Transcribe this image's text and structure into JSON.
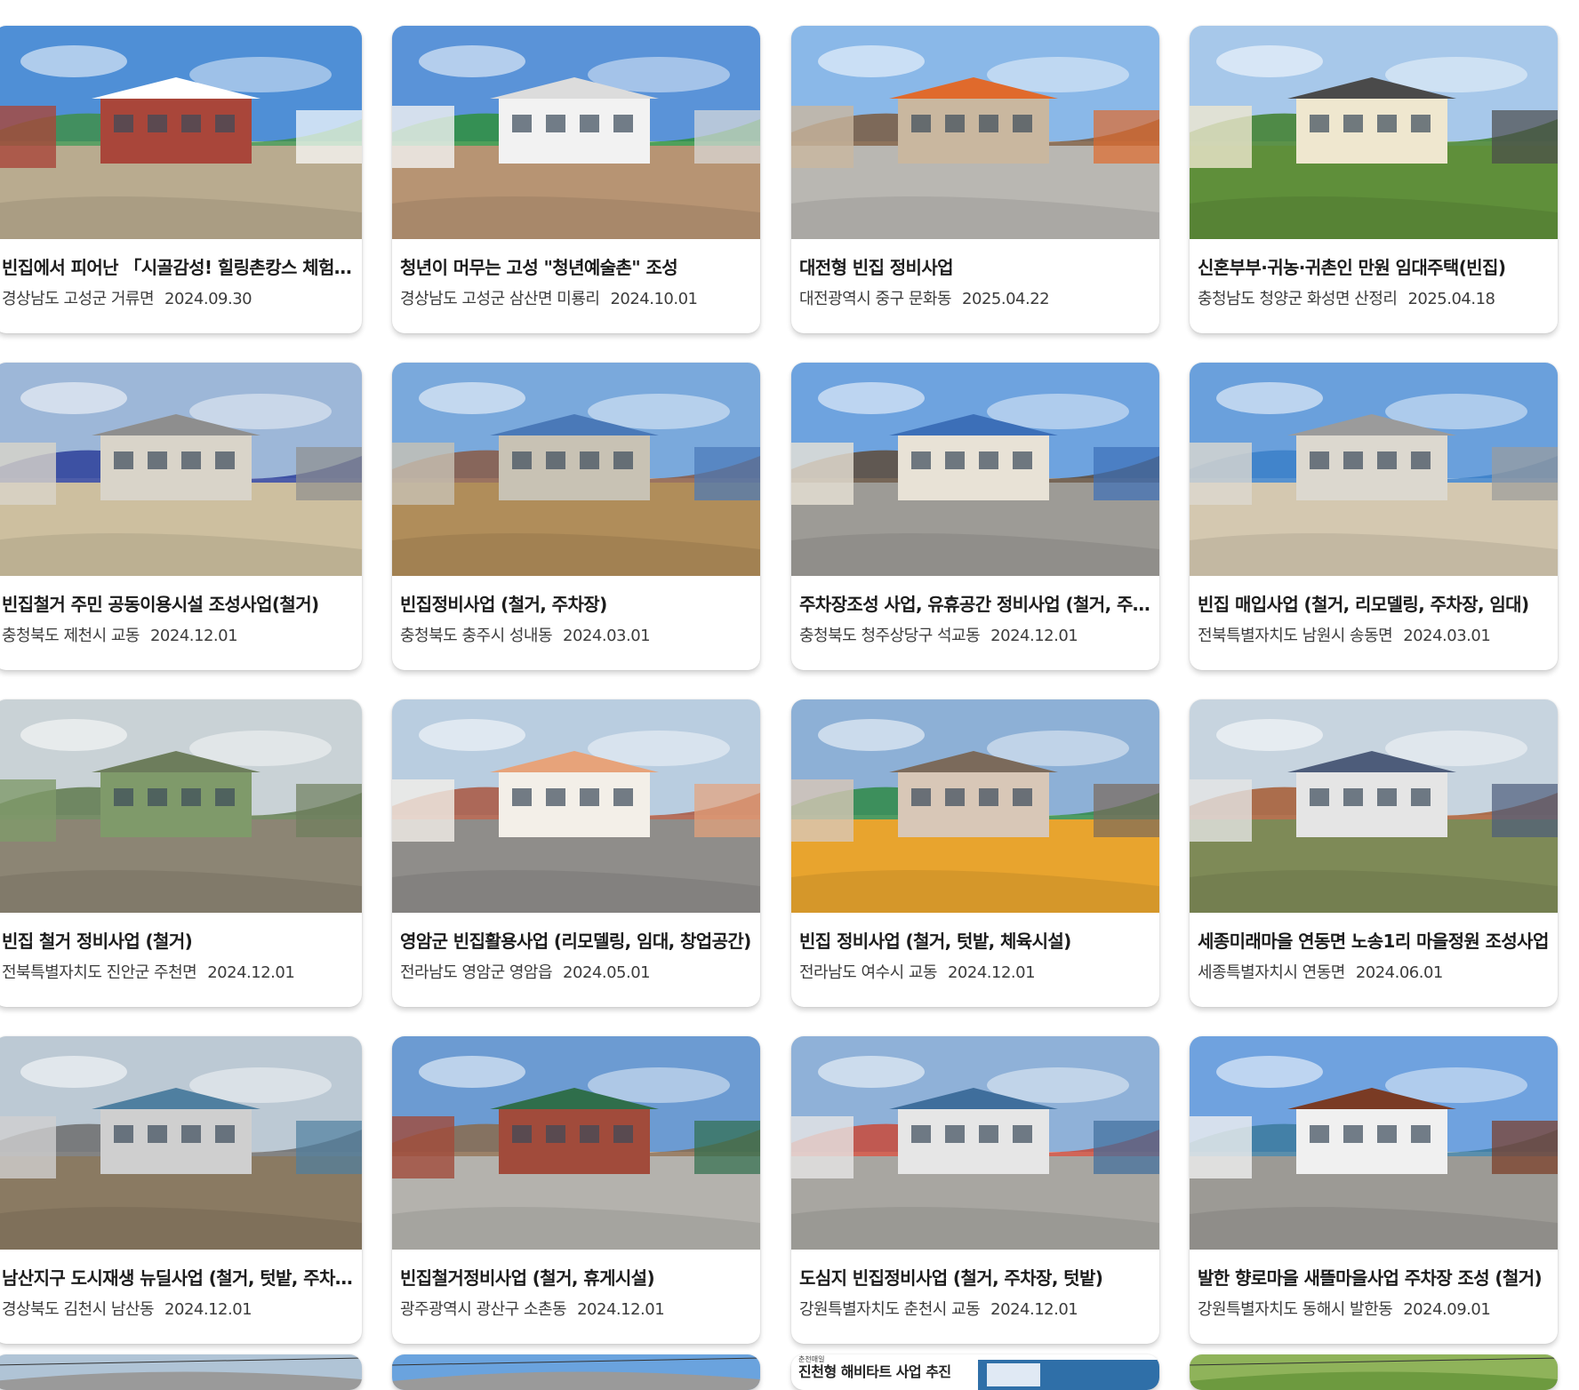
{
  "cards": [
    {
      "title": "빈집에서 피어난 「시골감성! 힐링촌캉스 체험관」",
      "location": "경상남도 고성군 거류면",
      "date": "2024.09.30"
    },
    {
      "title": "청년이 머무는 고성 \"청년예술촌\" 조성",
      "location": "경상남도 고성군 삼산면 미룡리",
      "date": "2024.10.01"
    },
    {
      "title": "대전형 빈집 정비사업",
      "location": "대전광역시 중구 문화동",
      "date": "2025.04.22"
    },
    {
      "title": "신혼부부·귀농·귀촌인 만원 임대주택(빈집)",
      "location": "충청남도 청양군 화성면 산정리",
      "date": "2025.04.18"
    },
    {
      "title": "빈집철거 주민 공동이용시설 조성사업(철거)",
      "location": "충청북도 제천시 교동",
      "date": "2024.12.01"
    },
    {
      "title": "빈집정비사업 (철거, 주차장)",
      "location": "충청북도 충주시 성내동",
      "date": "2024.03.01"
    },
    {
      "title": "주차장조성 사업, 유휴공간 정비사업 (철거, 주차장)",
      "location": "충청북도 청주상당구 석교동",
      "date": "2024.12.01"
    },
    {
      "title": "빈집 매입사업 (철거, 리모델링, 주차장, 임대)",
      "location": "전북특별자치도 남원시 송동면",
      "date": "2024.03.01"
    },
    {
      "title": "빈집 철거 정비사업 (철거)",
      "location": "전북특별자치도 진안군 주천면",
      "date": "2024.12.01"
    },
    {
      "title": "영암군 빈집활용사업 (리모델링, 임대, 창업공간)",
      "location": "전라남도 영암군 영암읍",
      "date": "2024.05.01"
    },
    {
      "title": "빈집 정비사업 (철거, 텃밭, 체육시설)",
      "location": "전라남도 여수시 교동",
      "date": "2024.12.01"
    },
    {
      "title": "세종미래마을 연동면 노송1리 마을정원 조성사업",
      "location": "세종특별자치시 연동면",
      "date": "2024.06.01"
    },
    {
      "title": "남산지구 도시재생 뉴딜사업 (철거, 텃밭, 주차장)",
      "location": "경상북도 김천시 남산동",
      "date": "2024.12.01"
    },
    {
      "title": "빈집철거정비사업 (철거, 휴게시설)",
      "location": "광주광역시 광산구 소촌동",
      "date": "2024.12.01"
    },
    {
      "title": "도심지 빈집정비사업 (철거, 주차장, 텃밭)",
      "location": "강원특별자치도 춘천시 교동",
      "date": "2024.12.01"
    },
    {
      "title": "발한 향로마을 새뜰마을사업 주차장 조성 (철거)",
      "location": "강원특별자치도 동해시 발한동",
      "date": "2024.09.01"
    }
  ],
  "partial_banner": {
    "small": "춘천매일",
    "headline": "진천형 해비타트 사업 추진"
  },
  "scenes": [
    {
      "sky": "#4f8fd6",
      "ground": "#b9ab8f",
      "building": "#a9463a",
      "roof": "#ffffff",
      "accent": "#3f8f4a"
    },
    {
      "sky": "#5a93d8",
      "ground": "#b79473",
      "building": "#f2f2f2",
      "roof": "#dcdcdc",
      "accent": "#2f8f3d"
    },
    {
      "sky": "#8ab8e8",
      "ground": "#b9b7b2",
      "building": "#c9b79f",
      "roof": "#e06a2c",
      "accent": "#7a5a40"
    },
    {
      "sky": "#a7c8ea",
      "ground": "#5f8f3a",
      "building": "#efe7cf",
      "roof": "#4a4a4a",
      "accent": "#3f7f2a"
    },
    {
      "sky": "#9db7d8",
      "ground": "#cdbf9f",
      "building": "#d9d4c9",
      "roof": "#8e8e8e",
      "accent": "#2d3f9a"
    },
    {
      "sky": "#7aa9dc",
      "ground": "#b08d5a",
      "building": "#c8c2b4",
      "roof": "#4a79b8",
      "accent": "#8a5a44"
    },
    {
      "sky": "#6ea3df",
      "ground": "#9d9b96",
      "building": "#e8e2d6",
      "roof": "#3c6fb8",
      "accent": "#5e4b3a"
    },
    {
      "sky": "#6aa0dc",
      "ground": "#d4c8b0",
      "building": "#dcd8cf",
      "roof": "#9b9b9b",
      "accent": "#3a7fc8"
    },
    {
      "sky": "#c9d2d6",
      "ground": "#8c8574",
      "building": "#7f9a6a",
      "roof": "#6d7d5c",
      "accent": "#5f7a4d"
    },
    {
      "sky": "#b9cde0",
      "ground": "#8f8d8a",
      "building": "#f3efe8",
      "roof": "#e7a37a",
      "accent": "#a9563f"
    },
    {
      "sky": "#8db0d6",
      "ground": "#e8a42e",
      "building": "#d8c7b7",
      "roof": "#7b6a5b",
      "accent": "#2f8a47"
    },
    {
      "sky": "#c7d4df",
      "ground": "#7e8a57",
      "building": "#e5e5e5",
      "roof": "#4d5c7a",
      "accent": "#a65a32"
    },
    {
      "sky": "#bcc9d4",
      "ground": "#8a7a62",
      "building": "#cfcfcf",
      "roof": "#4f7fa0",
      "accent": "#6d6d6d"
    },
    {
      "sky": "#6c9bd2",
      "ground": "#b4b2ad",
      "building": "#a14b3b",
      "roof": "#2f6e4b",
      "accent": "#8a6b4e"
    },
    {
      "sky": "#8fb1d8",
      "ground": "#a8a6a1",
      "building": "#e6e6e6",
      "roof": "#3f6e9c",
      "accent": "#c94a3a"
    },
    {
      "sky": "#6fa2df",
      "ground": "#9c9a95",
      "building": "#f0f0f0",
      "roof": "#7a3b24",
      "accent": "#3c7a9e"
    },
    {
      "sky": "#b0c4d6",
      "ground": "#9a9a9a",
      "building": "#cfcfcf",
      "roof": "#7d7d7d",
      "accent": "#888888"
    },
    {
      "sky": "#6aa3de",
      "ground": "#9a9a9a",
      "building": "#d0d0d0",
      "roof": "#555555",
      "accent": "#888888"
    },
    {
      "sky": "#ffffff",
      "ground": "#ffffff",
      "building": "#2f6fa8",
      "roof": "#e0e9f4",
      "accent": "#2c5fa5"
    },
    {
      "sky": "#8fb35a",
      "ground": "#6d9a3f",
      "building": "#5e8a3a",
      "roof": "#4f7a30",
      "accent": "#3f6a26"
    }
  ]
}
